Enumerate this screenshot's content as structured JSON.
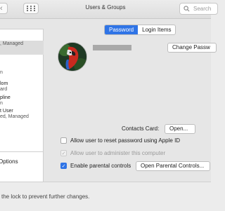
{
  "window": {
    "title": "Users & Groups"
  },
  "search": {
    "placeholder": "Search"
  },
  "sidebar": {
    "users": [
      {
        "name": "",
        "role": "Managed"
      },
      {
        "name": "",
        "role": "n"
      },
      {
        "name": "lom",
        "role": "ard"
      },
      {
        "name": "pline",
        "role": "n"
      },
      {
        "name": "t User",
        "role": "ed, Managed"
      }
    ],
    "options_label": "Options"
  },
  "tabs": [
    "Password",
    "Login Items"
  ],
  "buttons": {
    "change_password": "Change Passw",
    "open": "Open...",
    "open_parental": "Open Parental Controls..."
  },
  "contacts_card_label": "Contacts Card:",
  "checkboxes": [
    {
      "label": "Allow user to reset password using Apple ID",
      "checked": false,
      "disabled": false
    },
    {
      "label": "Allow user to administer this computer",
      "checked": true,
      "disabled": true
    },
    {
      "label": "Enable parental controls",
      "checked": true,
      "disabled": false
    }
  ],
  "footer": {
    "lock_text": "the lock to prevent further changes."
  },
  "colors": {
    "accent": "#2f74e6"
  }
}
